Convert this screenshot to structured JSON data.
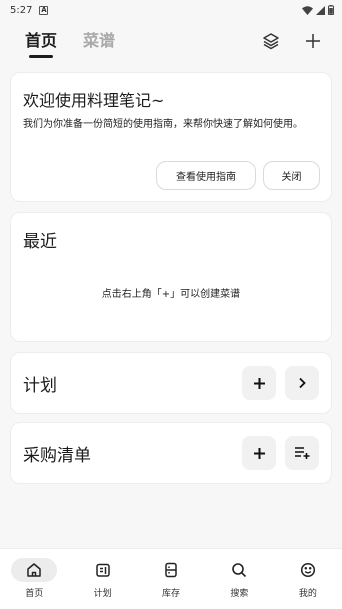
{
  "status_bar": {
    "time": "5:27",
    "notification_letter": "A"
  },
  "header": {
    "tabs": [
      {
        "label": "首页",
        "active": true
      },
      {
        "label": "菜谱",
        "active": false
      }
    ],
    "actions": [
      "layers-icon",
      "plus-icon"
    ]
  },
  "welcome": {
    "title": "欢迎使用料理笔记~",
    "body": "我们为你准备一份简短的使用指南，来帮你快速了解如何使用。",
    "guide_button": "查看使用指南",
    "close_button": "关闭"
  },
  "recent": {
    "title": "最近",
    "empty_text": "点击右上角「+」可以创建菜谱"
  },
  "plan": {
    "title": "计划",
    "add_icon": "plus-icon",
    "open_icon": "chevron-right-icon"
  },
  "shopping": {
    "title": "采购清单",
    "add_icon": "plus-icon",
    "list_add_icon": "playlist-add-icon"
  },
  "bottom_nav": {
    "items": [
      {
        "label": "首页",
        "icon": "home-icon",
        "active": true
      },
      {
        "label": "计划",
        "icon": "calendar-icon",
        "active": false
      },
      {
        "label": "库存",
        "icon": "fridge-icon",
        "active": false
      },
      {
        "label": "搜索",
        "icon": "search-icon",
        "active": false
      },
      {
        "label": "我的",
        "icon": "smiley-icon",
        "active": false
      }
    ]
  },
  "colors": {
    "background": "#f7f7f7",
    "card": "#ffffff",
    "button_bg": "#f1f1f1",
    "text": "#1c1c1c",
    "inactive_tab": "#a9a9a9"
  }
}
